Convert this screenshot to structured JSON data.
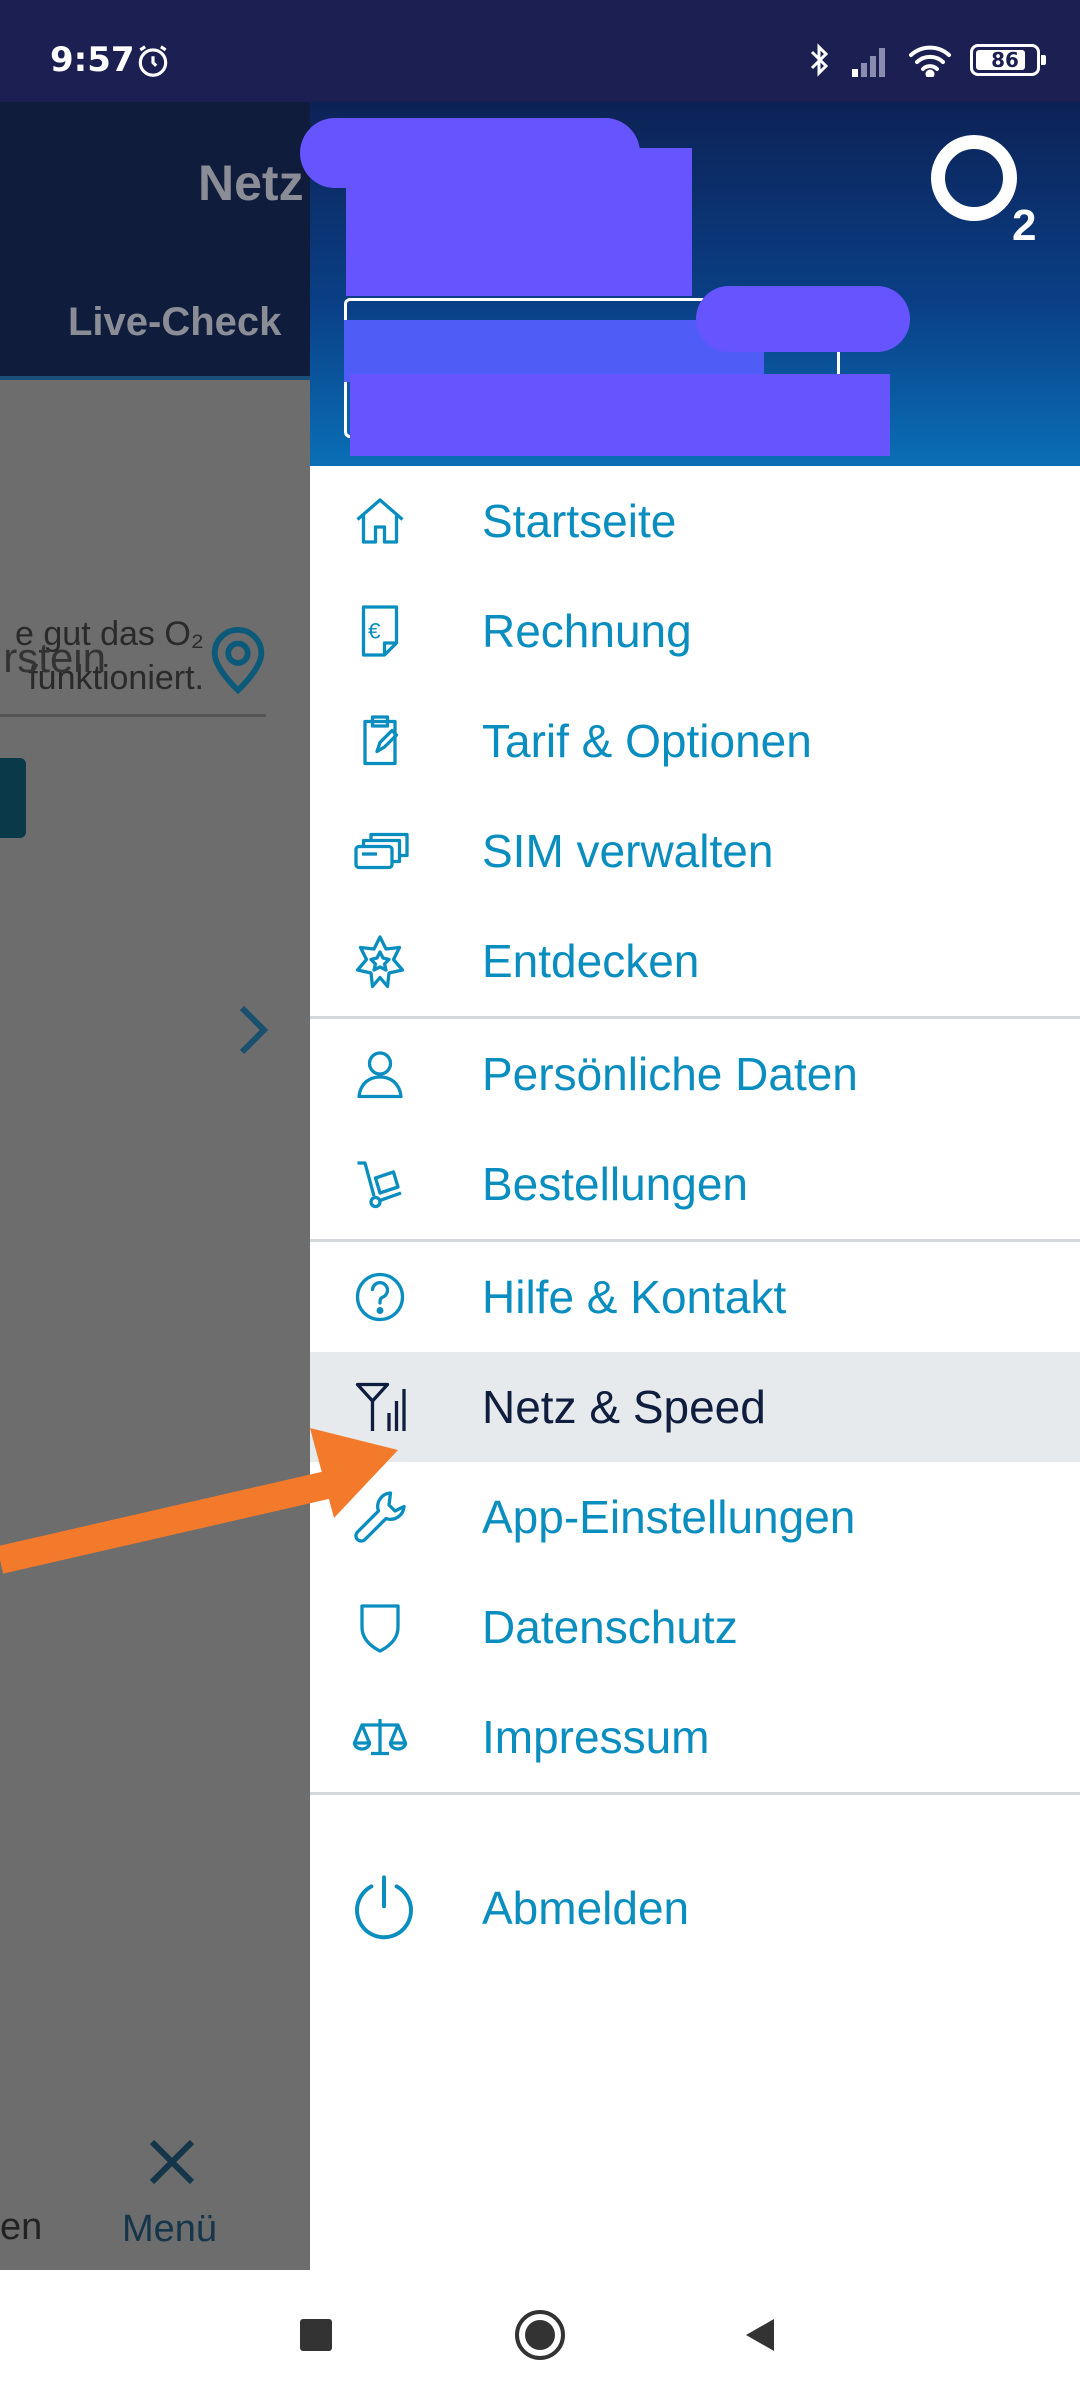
{
  "status_bar": {
    "time": "9:57",
    "battery": "86",
    "battery_level": 0.86
  },
  "background_page": {
    "title": "Netz",
    "tab": "Live-Check",
    "text_line1": "e gut das O₂",
    "text_line2": "funktioniert.",
    "input_text": "rstein",
    "bottom_left_label": "en",
    "menu_label": "Menü"
  },
  "drawer": {
    "brand": {
      "letter": "O",
      "subscript": "2"
    },
    "sections": [
      {
        "items": [
          {
            "label": "Startseite",
            "icon": "home-icon"
          },
          {
            "label": "Rechnung",
            "icon": "invoice-euro-icon"
          },
          {
            "label": "Tarif & Optionen",
            "icon": "clipboard-edit-icon"
          },
          {
            "label": "SIM verwalten",
            "icon": "sim-cards-icon"
          },
          {
            "label": "Entdecken",
            "icon": "star-badge-icon"
          }
        ]
      },
      {
        "items": [
          {
            "label": "Persönliche Daten",
            "icon": "person-icon"
          },
          {
            "label": "Bestellungen",
            "icon": "hand-truck-icon"
          }
        ]
      },
      {
        "items": [
          {
            "label": "Hilfe & Kontakt",
            "icon": "help-icon"
          },
          {
            "label": "Netz & Speed",
            "icon": "antenna-signal-icon",
            "active": true
          },
          {
            "label": "App-Einstellungen",
            "icon": "wrench-icon"
          },
          {
            "label": "Datenschutz",
            "icon": "shield-icon"
          },
          {
            "label": "Impressum",
            "icon": "scales-icon"
          }
        ]
      }
    ],
    "logout": {
      "label": "Abmelden",
      "icon": "power-icon"
    }
  },
  "colors": {
    "accent": "#0a8dbf",
    "active_text": "#0f1d3e",
    "active_bg": "#e6eaec",
    "status_bar": "#1c1f52",
    "annotation_arrow": "#f47a2b",
    "redaction": "#6654ff"
  }
}
